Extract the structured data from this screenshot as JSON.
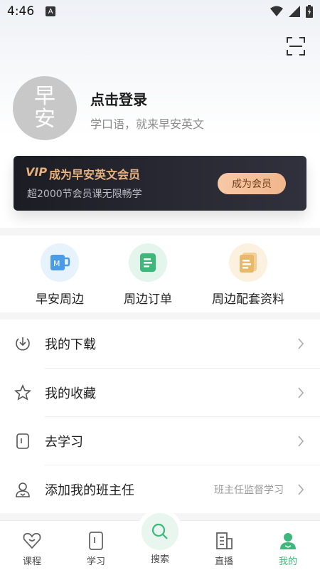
{
  "status_bar": {
    "time": "4:46",
    "a_badge": "A"
  },
  "profile": {
    "avatar_chars": [
      "早",
      "安"
    ],
    "login_title": "点击登录",
    "login_subtitle": "学口语，就来早安英文"
  },
  "vip": {
    "logo": "VIP",
    "title": "成为早安英文会员",
    "subtitle": "超2000节会员课无限畅学",
    "button": "成为会员"
  },
  "shortcuts": [
    {
      "label": "早安周边",
      "icon": "mug-icon"
    },
    {
      "label": "周边订单",
      "icon": "order-icon"
    },
    {
      "label": "周边配套资料",
      "icon": "document-icon"
    }
  ],
  "menu": [
    {
      "label": "我的下载",
      "icon": "download-icon",
      "extra": ""
    },
    {
      "label": "我的收藏",
      "icon": "star-icon",
      "extra": ""
    },
    {
      "label": "去学习",
      "icon": "book-icon",
      "extra": ""
    },
    {
      "label": "添加我的班主任",
      "icon": "person-icon",
      "extra": "班主任监督学习"
    }
  ],
  "tabs": [
    {
      "label": "课程",
      "icon": "heart-icon"
    },
    {
      "label": "学习",
      "icon": "book-icon"
    },
    {
      "label": "搜索",
      "icon": "search-icon"
    },
    {
      "label": "直播",
      "icon": "building-icon"
    },
    {
      "label": "我的",
      "icon": "person-icon",
      "active": true
    }
  ],
  "colors": {
    "accent_green": "#3cb97a",
    "vip_gold": "#e8b37e",
    "vip_bg": "#1c1c24"
  }
}
